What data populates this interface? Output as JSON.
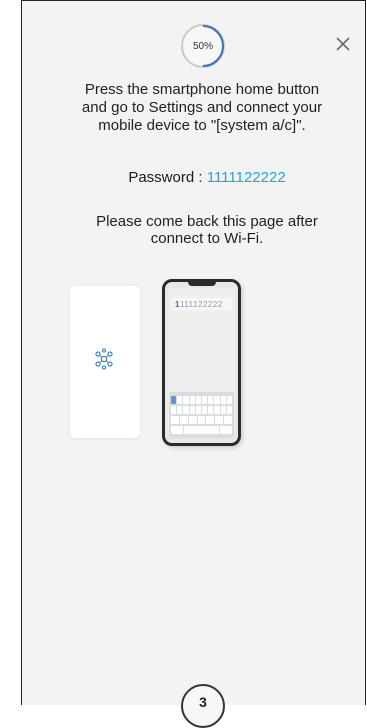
{
  "header": {
    "progress_label": "50%",
    "progress_value": 0.5,
    "close_icon": "close-icon"
  },
  "instruction": {
    "lines": [
      "Press the smartphone home button",
      "and go to Settings and connect your",
      "mobile device to \"[system a/c]\"."
    ]
  },
  "password": {
    "label": "Password : ",
    "value": "1111122222",
    "value_color": "#24a3dc"
  },
  "comeback": {
    "lines": [
      "Please come back this page after",
      "connect to Wi-Fi."
    ]
  },
  "illustration": {
    "left_card_icon": "wifi-network-icon",
    "phone_field_first": "1",
    "phone_field_rest": "111122222"
  },
  "footer": {
    "next_step_label": "3"
  }
}
